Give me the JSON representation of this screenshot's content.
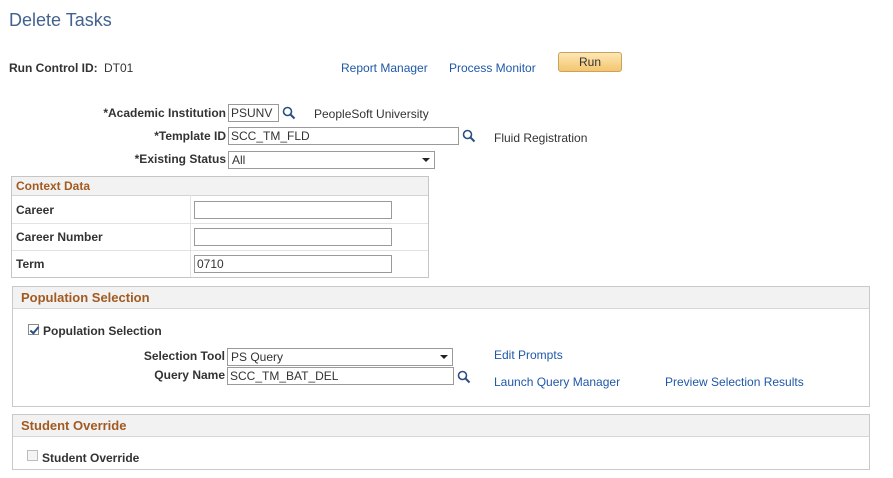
{
  "page": {
    "title": "Delete Tasks"
  },
  "header": {
    "run_control_label": "Run Control ID:",
    "run_control_value": "DT01",
    "report_manager": "Report Manager",
    "process_monitor": "Process Monitor",
    "run_button": "Run"
  },
  "form": {
    "institution_label": "*Academic Institution",
    "institution_value": "PSUNV",
    "institution_desc": "PeopleSoft University",
    "template_label": "*Template ID",
    "template_value": "SCC_TM_FLD",
    "template_desc": "Fluid Registration",
    "status_label": "*Existing Status",
    "status_value": "All"
  },
  "context": {
    "title": "Context Data",
    "rows": [
      {
        "label": "Career",
        "value": ""
      },
      {
        "label": "Career Number",
        "value": ""
      },
      {
        "label": "Term",
        "value": "0710"
      }
    ]
  },
  "population": {
    "title": "Population Selection",
    "checkbox_label": "Population Selection",
    "checked": true,
    "tool_label": "Selection Tool",
    "tool_value": "PS Query",
    "query_label": "Query Name",
    "query_value": "SCC_TM_BAT_DEL",
    "edit_prompts": "Edit Prompts",
    "launch_query_manager": "Launch Query Manager",
    "preview_results": "Preview Selection Results"
  },
  "override": {
    "title": "Student Override",
    "checkbox_label": "Student Override",
    "checked": false
  },
  "icons": {
    "lookup": "magnifier-icon",
    "dropdown": "chevron-down-icon",
    "checkbox": "checkmark-icon"
  },
  "colors": {
    "title": "#43628f",
    "link": "#1f58a8",
    "section_title": "#a25a20",
    "run_button": "#f4c56f"
  }
}
